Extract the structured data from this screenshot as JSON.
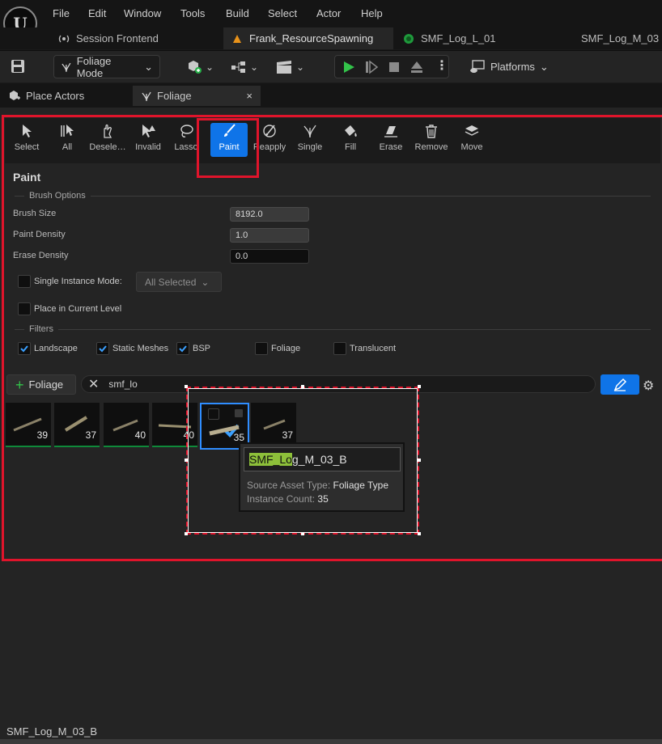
{
  "menu": [
    "File",
    "Edit",
    "Window",
    "Tools",
    "Build",
    "Select",
    "Actor",
    "Help"
  ],
  "doc_tabs": [
    {
      "label": "Session Frontend",
      "icon": "radio-tower-icon"
    },
    {
      "label": "Frank_ResourceSpawning",
      "icon": "level-icon"
    },
    {
      "label": "SMF_Log_L_01",
      "icon": "foliage-type-icon"
    },
    {
      "label": "SMF_Log_M_03",
      "icon": "foliage-type-icon"
    }
  ],
  "toolbar": {
    "mode_label": "Foliage Mode",
    "platforms_label": "Platforms"
  },
  "panel_tabs": {
    "place_actors": "Place Actors",
    "foliage": "Foliage",
    "close": "×"
  },
  "tools": [
    {
      "label": "Select",
      "icon": "cursor-icon"
    },
    {
      "label": "All",
      "icon": "select-all-icon"
    },
    {
      "label": "Desele…",
      "icon": "deselect-icon"
    },
    {
      "label": "Invalid",
      "icon": "invalid-icon"
    },
    {
      "label": "Lasso",
      "icon": "lasso-icon"
    },
    {
      "label": "Paint",
      "icon": "brush-icon"
    },
    {
      "label": "Reapply",
      "icon": "reapply-icon"
    },
    {
      "label": "Single",
      "icon": "single-icon"
    },
    {
      "label": "Fill",
      "icon": "fill-icon"
    },
    {
      "label": "Erase",
      "icon": "erase-icon"
    },
    {
      "label": "Remove",
      "icon": "trash-icon"
    },
    {
      "label": "Move",
      "icon": "move-icon"
    }
  ],
  "paint": {
    "title": "Paint",
    "brush_options": "Brush Options",
    "brush_size_label": "Brush Size",
    "brush_size": "8192.0",
    "paint_density_label": "Paint Density",
    "paint_density": "1.0",
    "erase_density_label": "Erase Density",
    "erase_density": "0.0",
    "single_instance_label": "Single Instance Mode:",
    "single_instance_value": "All Selected",
    "place_current_level": "Place in Current Level",
    "filters": "Filters",
    "filter_items": [
      {
        "label": "Landscape",
        "checked": true
      },
      {
        "label": "Static Meshes",
        "checked": true
      },
      {
        "label": "BSP",
        "checked": true
      },
      {
        "label": "Foliage",
        "checked": false
      },
      {
        "label": "Translucent",
        "checked": false
      }
    ]
  },
  "foliage_list": {
    "add_label": "Foliage",
    "search_value": "smf_lo",
    "thumbs": [
      {
        "count": "39"
      },
      {
        "count": "37"
      },
      {
        "count": "40"
      },
      {
        "count": "40"
      },
      {
        "count": "35"
      },
      {
        "count": "37"
      }
    ]
  },
  "tooltip": {
    "title_highlight": "SMF_Lo",
    "title_rest": "g_M_03_B",
    "source_label": "Source Asset Type:",
    "source_value": "Foliage Type",
    "count_label": "Instance Count:",
    "count_value": "35"
  },
  "status": {
    "text": "SMF_Log_M_03_B"
  },
  "colors": {
    "accent": "#0f74e8",
    "highlight_red": "#e0142b",
    "search_highlight": "#8dc03a"
  }
}
